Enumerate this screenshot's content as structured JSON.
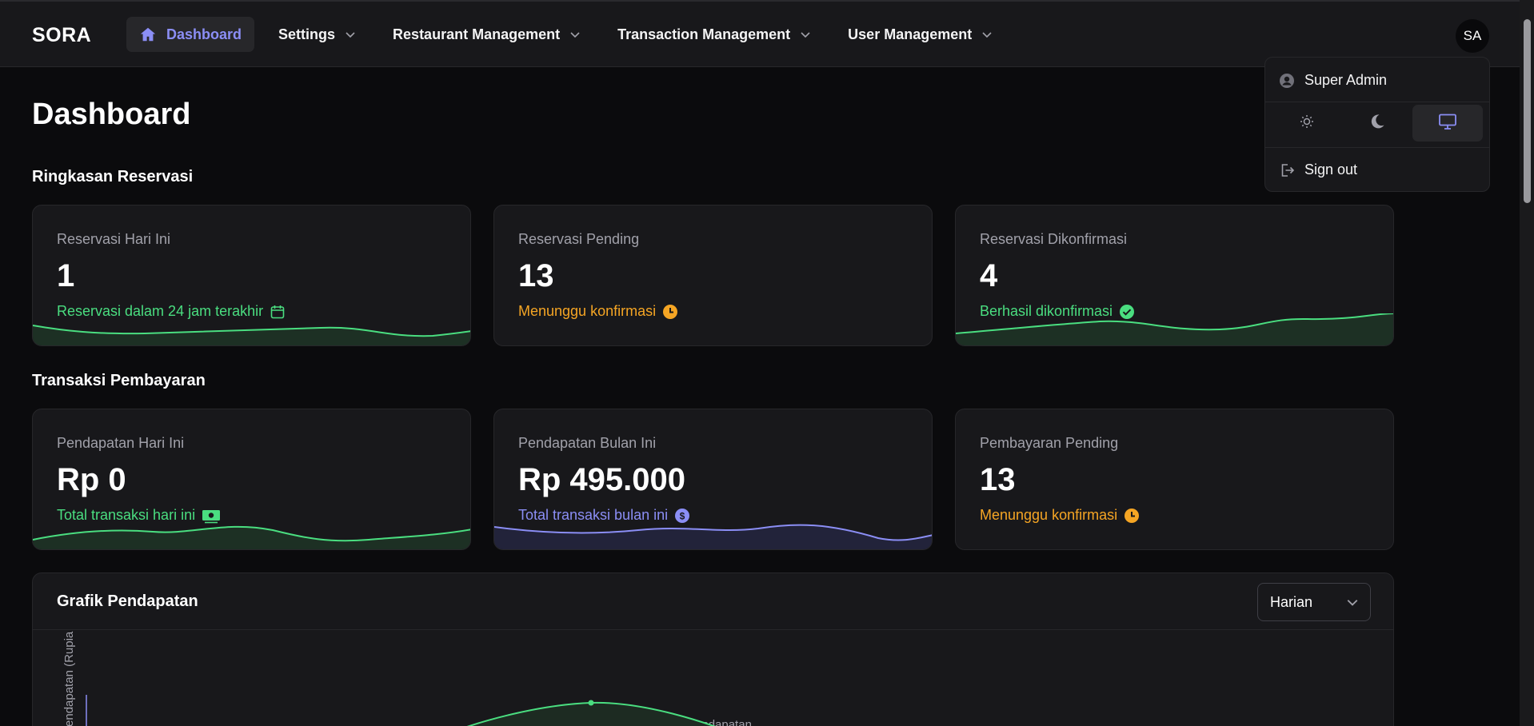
{
  "app": {
    "brand": "SORA"
  },
  "nav": {
    "items": [
      {
        "label": "Dashboard",
        "active": true
      },
      {
        "label": "Settings"
      },
      {
        "label": "Restaurant Management"
      },
      {
        "label": "Transaction Management"
      },
      {
        "label": "User Management"
      }
    ]
  },
  "user": {
    "initials": "SA",
    "name": "Super Admin"
  },
  "menu": {
    "signout": "Sign out",
    "theme_options": [
      "light",
      "dark",
      "system"
    ],
    "theme_selected": "system"
  },
  "page": {
    "title": "Dashboard"
  },
  "reservations": {
    "title": "Ringkasan Reservasi",
    "cards": [
      {
        "label": "Reservasi Hari Ini",
        "value": "1",
        "sub": "Reservasi dalam 24 jam terakhir",
        "icon": "calendar-icon",
        "color": "#4ade80"
      },
      {
        "label": "Reservasi Pending",
        "value": "13",
        "sub": "Menunggu konfirmasi",
        "icon": "clock-icon",
        "color": "#f5a524"
      },
      {
        "label": "Reservasi Dikonfirmasi",
        "value": "4",
        "sub": "Berhasil dikonfirmasi",
        "icon": "check-circle-icon",
        "color": "#4ade80"
      }
    ]
  },
  "payments": {
    "title": "Transaksi Pembayaran",
    "cards": [
      {
        "label": "Pendapatan Hari Ini",
        "value": "Rp 0",
        "sub": "Total transaksi hari ini",
        "icon": "cash-icon",
        "color": "#4ade80"
      },
      {
        "label": "Pendapatan Bulan Ini",
        "value": "Rp 495.000",
        "sub": "Total transaksi bulan ini",
        "icon": "dollar-circle-icon",
        "color": "#8b8ef5"
      },
      {
        "label": "Pembayaran Pending",
        "value": "13",
        "sub": "Menunggu konfirmasi",
        "icon": "clock-icon",
        "color": "#f5a524"
      }
    ]
  },
  "chart_panel": {
    "title": "Grafik Pendapatan",
    "period_selected": "Harian"
  },
  "chart_data": {
    "type": "line",
    "series": [
      {
        "name": "Pendapatan"
      }
    ],
    "ylabel": "Pendapatan (Rupiah)",
    "legend": "top-center",
    "color": "#4ade80"
  },
  "colors": {
    "accent": "#8b8ef5",
    "success": "#4ade80",
    "warning": "#f5a524"
  }
}
